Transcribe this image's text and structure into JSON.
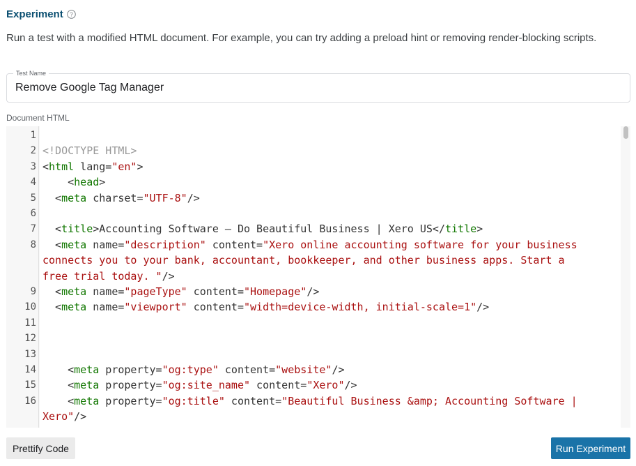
{
  "experiment": {
    "title": "Experiment",
    "description": "Run a test with a modified HTML document. For example, you can try adding a preload hint or removing render-blocking scripts."
  },
  "test_name": {
    "label": "Test Name",
    "value": "Remove Google Tag Manager"
  },
  "document_html": {
    "label": "Document HTML",
    "lines": [
      {
        "n": "1",
        "tokens": []
      },
      {
        "n": "2",
        "tokens": [
          {
            "c": "meta",
            "t": "<!DOCTYPE HTML>"
          }
        ]
      },
      {
        "n": "3",
        "tokens": [
          {
            "c": "br",
            "t": "<"
          },
          {
            "c": "tag",
            "t": "html"
          },
          {
            "c": "attr",
            "t": " lang="
          },
          {
            "c": "str",
            "t": "\"en\""
          },
          {
            "c": "br",
            "t": ">"
          }
        ]
      },
      {
        "n": "4",
        "tokens": [
          {
            "c": "br",
            "t": "    <"
          },
          {
            "c": "tag",
            "t": "head"
          },
          {
            "c": "br",
            "t": ">"
          }
        ]
      },
      {
        "n": "5",
        "tokens": [
          {
            "c": "br",
            "t": "  <"
          },
          {
            "c": "tag",
            "t": "meta"
          },
          {
            "c": "attr",
            "t": " charset="
          },
          {
            "c": "str",
            "t": "\"UTF-8\""
          },
          {
            "c": "br",
            "t": "/>"
          }
        ]
      },
      {
        "n": "6",
        "tokens": []
      },
      {
        "n": "7",
        "tokens": [
          {
            "c": "br",
            "t": "  <"
          },
          {
            "c": "tag",
            "t": "title"
          },
          {
            "c": "br",
            "t": ">Accounting Software — Do Beautiful Business | Xero US</"
          },
          {
            "c": "tag",
            "t": "title"
          },
          {
            "c": "br",
            "t": ">"
          }
        ]
      },
      {
        "n": "8",
        "tokens": [
          {
            "c": "br",
            "t": "  <"
          },
          {
            "c": "tag",
            "t": "meta"
          },
          {
            "c": "attr",
            "t": " name="
          },
          {
            "c": "str",
            "t": "\"description\""
          },
          {
            "c": "attr",
            "t": " content="
          },
          {
            "c": "str",
            "t": "\"Xero online accounting software for your business"
          }
        ]
      },
      {
        "n": "",
        "tokens": [
          {
            "c": "str",
            "t": "connects you to your bank, accountant, bookkeeper, and other business apps. Start a"
          }
        ]
      },
      {
        "n": "",
        "tokens": [
          {
            "c": "str",
            "t": "free trial today. \""
          },
          {
            "c": "br",
            "t": "/>"
          }
        ]
      },
      {
        "n": "9",
        "tokens": [
          {
            "c": "br",
            "t": "  <"
          },
          {
            "c": "tag",
            "t": "meta"
          },
          {
            "c": "attr",
            "t": " name="
          },
          {
            "c": "str",
            "t": "\"pageType\""
          },
          {
            "c": "attr",
            "t": " content="
          },
          {
            "c": "str",
            "t": "\"Homepage\""
          },
          {
            "c": "br",
            "t": "/>"
          }
        ]
      },
      {
        "n": "10",
        "tokens": [
          {
            "c": "br",
            "t": "  <"
          },
          {
            "c": "tag",
            "t": "meta"
          },
          {
            "c": "attr",
            "t": " name="
          },
          {
            "c": "str",
            "t": "\"viewport\""
          },
          {
            "c": "attr",
            "t": " content="
          },
          {
            "c": "str",
            "t": "\"width=device-width, initial-scale=1\""
          },
          {
            "c": "br",
            "t": "/>"
          }
        ]
      },
      {
        "n": "11",
        "tokens": []
      },
      {
        "n": "12",
        "tokens": []
      },
      {
        "n": "13",
        "tokens": []
      },
      {
        "n": "14",
        "tokens": [
          {
            "c": "br",
            "t": "    <"
          },
          {
            "c": "tag",
            "t": "meta"
          },
          {
            "c": "attr",
            "t": " property="
          },
          {
            "c": "str",
            "t": "\"og:type\""
          },
          {
            "c": "attr",
            "t": " content="
          },
          {
            "c": "str",
            "t": "\"website\""
          },
          {
            "c": "br",
            "t": "/>"
          }
        ]
      },
      {
        "n": "15",
        "tokens": [
          {
            "c": "br",
            "t": "    <"
          },
          {
            "c": "tag",
            "t": "meta"
          },
          {
            "c": "attr",
            "t": " property="
          },
          {
            "c": "str",
            "t": "\"og:site_name\""
          },
          {
            "c": "attr",
            "t": " content="
          },
          {
            "c": "str",
            "t": "\"Xero\""
          },
          {
            "c": "br",
            "t": "/>"
          }
        ]
      },
      {
        "n": "16",
        "tokens": [
          {
            "c": "br",
            "t": "    <"
          },
          {
            "c": "tag",
            "t": "meta"
          },
          {
            "c": "attr",
            "t": " property="
          },
          {
            "c": "str",
            "t": "\"og:title\""
          },
          {
            "c": "attr",
            "t": " content="
          },
          {
            "c": "str",
            "t": "\"Beautiful Business &amp; Accounting Software |"
          }
        ]
      },
      {
        "n": "",
        "tokens": [
          {
            "c": "str",
            "t": "Xero\""
          },
          {
            "c": "br",
            "t": "/>"
          }
        ]
      }
    ]
  },
  "buttons": {
    "prettify": "Prettify Code",
    "run": "Run Experiment"
  },
  "icons": {
    "help": "help-circle-icon"
  }
}
